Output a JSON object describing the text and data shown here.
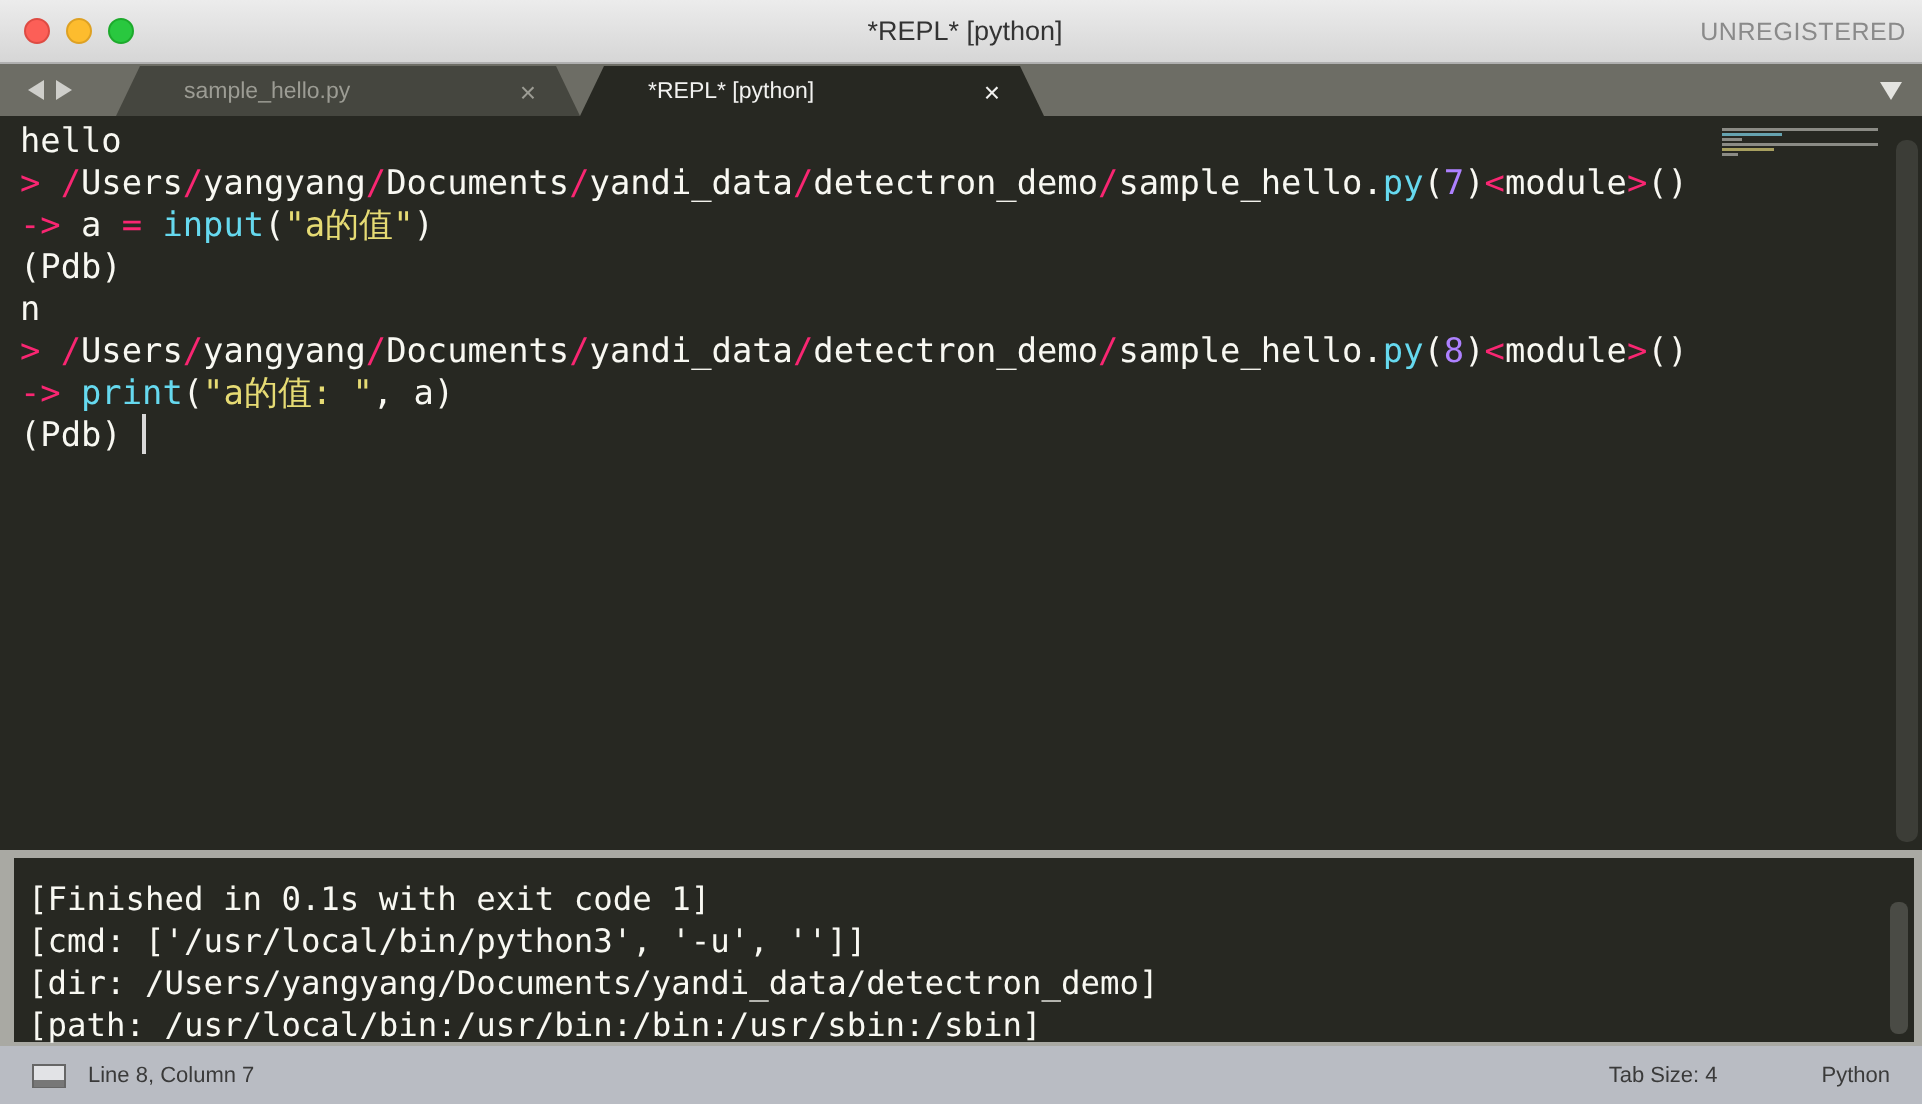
{
  "window": {
    "title": "*REPL* [python]",
    "badge": "UNREGISTERED"
  },
  "tabs": [
    {
      "label": "sample_hello.py",
      "close": "×",
      "selected": false
    },
    {
      "label": "*REPL* [python]",
      "close": "×",
      "selected": true
    }
  ],
  "editor": {
    "lines": [
      {
        "cursor": false,
        "segments": [
          {
            "kind": "plain",
            "text": "hello"
          }
        ]
      },
      {
        "cursor": false,
        "segments": [
          {
            "kind": "op",
            "text": "> /"
          },
          {
            "kind": "plain",
            "text": "Users"
          },
          {
            "kind": "op",
            "text": "/"
          },
          {
            "kind": "plain",
            "text": "yangyang"
          },
          {
            "kind": "op",
            "text": "/"
          },
          {
            "kind": "plain",
            "text": "Documents"
          },
          {
            "kind": "op",
            "text": "/"
          },
          {
            "kind": "plain",
            "text": "yandi_data"
          },
          {
            "kind": "op",
            "text": "/"
          },
          {
            "kind": "plain",
            "text": "detectron_demo"
          },
          {
            "kind": "op",
            "text": "/"
          },
          {
            "kind": "plain",
            "text": "sample_hello."
          },
          {
            "kind": "func",
            "text": "py"
          },
          {
            "kind": "plain",
            "text": "("
          },
          {
            "kind": "num",
            "text": "7"
          },
          {
            "kind": "plain",
            "text": ")"
          },
          {
            "kind": "op",
            "text": "<"
          },
          {
            "kind": "plain",
            "text": "module"
          },
          {
            "kind": "op",
            "text": ">"
          },
          {
            "kind": "plain",
            "text": "()"
          }
        ]
      },
      {
        "cursor": false,
        "segments": [
          {
            "kind": "op",
            "text": "->"
          },
          {
            "kind": "plain",
            "text": " a "
          },
          {
            "kind": "op",
            "text": "= "
          },
          {
            "kind": "func",
            "text": "input"
          },
          {
            "kind": "plain",
            "text": "("
          },
          {
            "kind": "str",
            "text": "\"a的值\""
          },
          {
            "kind": "plain",
            "text": ")"
          }
        ]
      },
      {
        "cursor": false,
        "segments": [
          {
            "kind": "plain",
            "text": "(Pdb)"
          }
        ]
      },
      {
        "cursor": false,
        "segments": [
          {
            "kind": "plain",
            "text": "n"
          }
        ]
      },
      {
        "cursor": false,
        "segments": [
          {
            "kind": "op",
            "text": "> /"
          },
          {
            "kind": "plain",
            "text": "Users"
          },
          {
            "kind": "op",
            "text": "/"
          },
          {
            "kind": "plain",
            "text": "yangyang"
          },
          {
            "kind": "op",
            "text": "/"
          },
          {
            "kind": "plain",
            "text": "Documents"
          },
          {
            "kind": "op",
            "text": "/"
          },
          {
            "kind": "plain",
            "text": "yandi_data"
          },
          {
            "kind": "op",
            "text": "/"
          },
          {
            "kind": "plain",
            "text": "detectron_demo"
          },
          {
            "kind": "op",
            "text": "/"
          },
          {
            "kind": "plain",
            "text": "sample_hello."
          },
          {
            "kind": "func",
            "text": "py"
          },
          {
            "kind": "plain",
            "text": "("
          },
          {
            "kind": "num",
            "text": "8"
          },
          {
            "kind": "plain",
            "text": ")"
          },
          {
            "kind": "op",
            "text": "<"
          },
          {
            "kind": "plain",
            "text": "module"
          },
          {
            "kind": "op",
            "text": ">"
          },
          {
            "kind": "plain",
            "text": "()"
          }
        ]
      },
      {
        "cursor": false,
        "segments": [
          {
            "kind": "op",
            "text": "-> "
          },
          {
            "kind": "func",
            "text": "print"
          },
          {
            "kind": "plain",
            "text": "("
          },
          {
            "kind": "str",
            "text": "\"a的值: \""
          },
          {
            "kind": "plain",
            "text": ", a)"
          }
        ]
      },
      {
        "cursor": true,
        "segments": [
          {
            "kind": "plain",
            "text": "(Pdb) "
          }
        ]
      }
    ]
  },
  "output": {
    "lines": [
      "[Finished in 0.1s with exit code 1]",
      "[cmd: ['/usr/local/bin/python3', '-u', '']]",
      "[dir: /Users/yangyang/Documents/yandi_data/detectron_demo]",
      "[path: /usr/local/bin:/usr/bin:/bin:/usr/sbin:/sbin]"
    ]
  },
  "status_bar": {
    "position": "Line 8, Column 7",
    "tab_size": "Tab Size: 4",
    "syntax": "Python"
  }
}
